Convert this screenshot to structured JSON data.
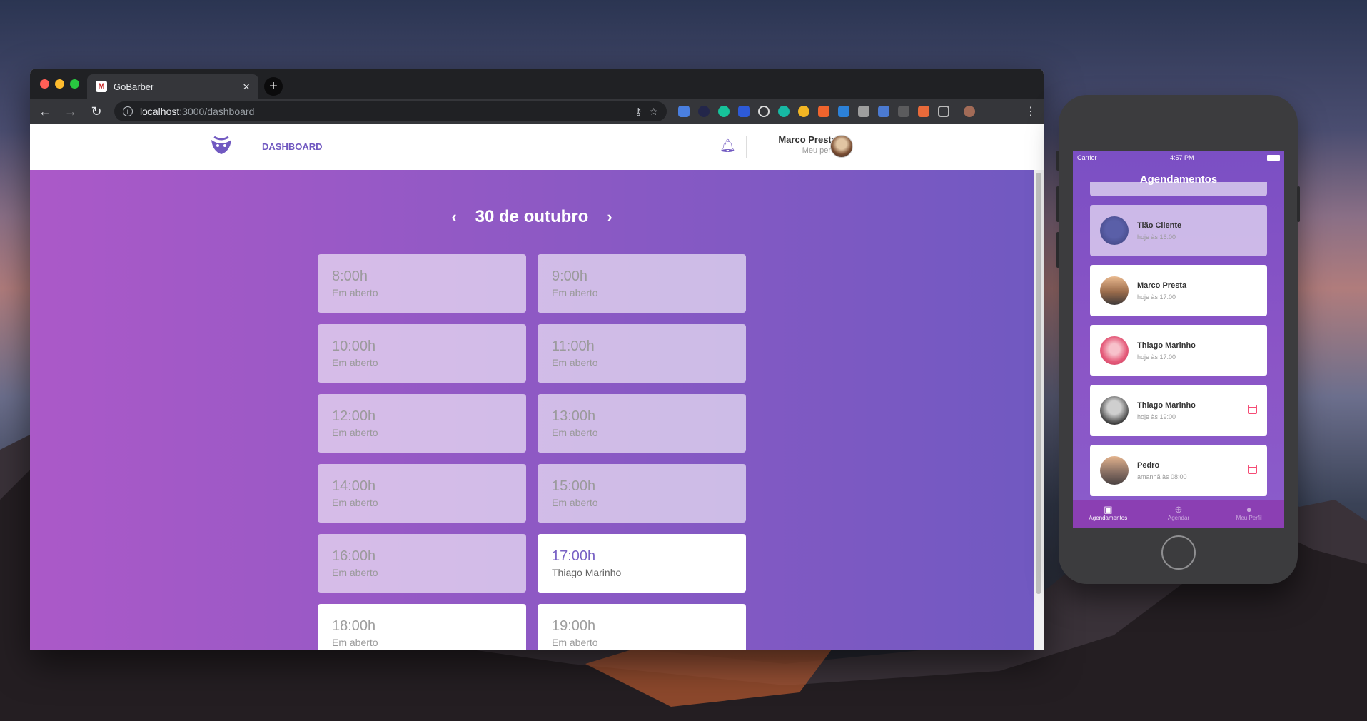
{
  "browser": {
    "tab_title": "GoBarber",
    "tab_favicon": "M",
    "url_host": "localhost",
    "url_path": ":3000/dashboard",
    "colors": {
      "chrome": "#35363a",
      "tabbar": "#202124"
    }
  },
  "app": {
    "nav_label": "DASHBOARD",
    "user_name": "Marco Presta",
    "user_link": "Meu perfil",
    "date_label": "30 de outubro",
    "brand_color": "#7159c1",
    "gradient": [
      "#ab59c8",
      "#7159c1"
    ],
    "slots": [
      {
        "time": "8:00h",
        "status": "Em aberto",
        "booked": false
      },
      {
        "time": "9:00h",
        "status": "Em aberto",
        "booked": false
      },
      {
        "time": "10:00h",
        "status": "Em aberto",
        "booked": false
      },
      {
        "time": "11:00h",
        "status": "Em aberto",
        "booked": false
      },
      {
        "time": "12:00h",
        "status": "Em aberto",
        "booked": false
      },
      {
        "time": "13:00h",
        "status": "Em aberto",
        "booked": false
      },
      {
        "time": "14:00h",
        "status": "Em aberto",
        "booked": false
      },
      {
        "time": "15:00h",
        "status": "Em aberto",
        "booked": false
      },
      {
        "time": "16:00h",
        "status": "Em aberto",
        "booked": false
      },
      {
        "time": "17:00h",
        "status": "Thiago Marinho",
        "booked": true
      },
      {
        "time": "18:00h",
        "status": "Em aberto",
        "booked": false
      },
      {
        "time": "19:00h",
        "status": "Em aberto",
        "booked": false
      }
    ]
  },
  "phone": {
    "carrier": "Carrier",
    "clock": "4:57 PM",
    "title": "Agendamentos",
    "appointments": [
      {
        "name": "Tião Cliente",
        "time": "hoje às 16:00",
        "past": true,
        "cancelable": false
      },
      {
        "name": "Marco Presta",
        "time": "hoje às 17:00",
        "past": false,
        "cancelable": false
      },
      {
        "name": "Thiago Marinho",
        "time": "hoje às 17:00",
        "past": false,
        "cancelable": false
      },
      {
        "name": "Thiago Marinho",
        "time": "hoje às 19:00",
        "past": false,
        "cancelable": true
      },
      {
        "name": "Pedro",
        "time": "amanhã às 08:00",
        "past": false,
        "cancelable": true
      }
    ],
    "tabs": [
      {
        "label": "Agendamentos",
        "icon": "calendar-icon",
        "active": true
      },
      {
        "label": "Agendar",
        "icon": "add-circle-icon",
        "active": false
      },
      {
        "label": "Meu Perfil",
        "icon": "person-icon",
        "active": false
      }
    ]
  }
}
